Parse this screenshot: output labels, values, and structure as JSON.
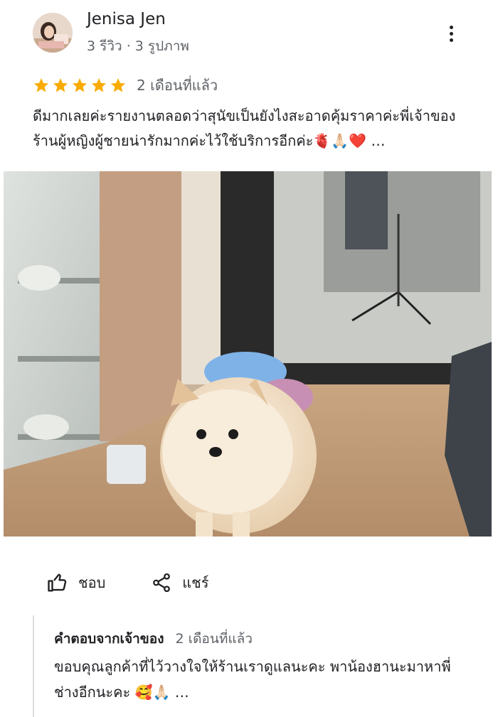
{
  "review": {
    "author": {
      "name": "Jenisa Jen",
      "meta": "3 รีวิว · 3 รูปภาพ"
    },
    "rating": 5,
    "max_rating": 5,
    "time": "2 เดือนที่แล้ว",
    "text": "ดีมากเลยค่ะรายงานตลอดว่าสุนัขเป็นยังไงสะอาดคุ้มราคาค่ะพี่เจ้าของร้านผู้หญิงผู้ชายน่ารักมากค่ะไว้ใช้บริการอีกค่ะ🫀🙏🏻❤️",
    "more": " …"
  },
  "colors": {
    "star": "#f9ab00",
    "text": "#202124",
    "secondary": "#5f6368"
  },
  "actions": {
    "like": {
      "label": "ชอบ",
      "icon": "thumbs-up-icon"
    },
    "share": {
      "label": "แชร์",
      "icon": "share-icon"
    }
  },
  "owner_reply": {
    "label": "คำตอบจากเจ้าของ",
    "time": "2 เดือนที่แล้ว",
    "text": "ขอบคุณลูกค้าที่ไว้วางใจให้ร้านเราดูแลนะคะ พาน้องฮานะมาหาพี่ช่างอีกนะคะ 🥰🙏🏻",
    "more": " …"
  }
}
